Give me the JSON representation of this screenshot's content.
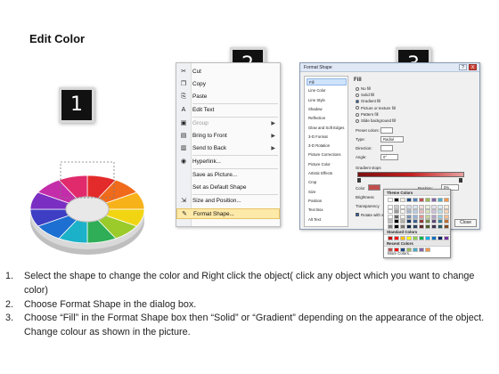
{
  "title": "Edit Color",
  "badges": [
    "1",
    "2",
    "3"
  ],
  "context_menu": {
    "items": [
      {
        "label": "Cut",
        "icon": "scissors-icon",
        "glyph": "✂",
        "disabled": false,
        "submenu": false
      },
      {
        "label": "Copy",
        "icon": "copy-icon",
        "glyph": "❐",
        "disabled": false,
        "submenu": false
      },
      {
        "label": "Paste",
        "icon": "paste-icon",
        "glyph": "⎘",
        "disabled": false,
        "submenu": false
      },
      {
        "label": "Edit Text",
        "icon": "edit-text-icon",
        "glyph": "A",
        "disabled": false,
        "submenu": false
      },
      {
        "label": "Group",
        "icon": "group-icon",
        "glyph": "▣",
        "disabled": true,
        "submenu": true
      },
      {
        "label": "Bring to Front",
        "icon": "bring-front-icon",
        "glyph": "▤",
        "disabled": false,
        "submenu": true
      },
      {
        "label": "Send to Back",
        "icon": "send-back-icon",
        "glyph": "▥",
        "disabled": false,
        "submenu": true
      },
      {
        "label": "Hyperlink...",
        "icon": "hyperlink-icon",
        "glyph": "◉",
        "disabled": false,
        "submenu": false
      },
      {
        "label": "Save as Picture...",
        "icon": "save-picture-icon",
        "glyph": "",
        "disabled": false,
        "submenu": false
      },
      {
        "label": "Set as Default Shape",
        "icon": "default-shape-icon",
        "glyph": "",
        "disabled": false,
        "submenu": false
      },
      {
        "label": "Size and Position...",
        "icon": "size-position-icon",
        "glyph": "⇲",
        "disabled": false,
        "submenu": false
      },
      {
        "label": "Format Shape...",
        "icon": "format-shape-icon",
        "glyph": "✎",
        "disabled": false,
        "submenu": false
      }
    ]
  },
  "dialog": {
    "title": "Format Shape",
    "help": "?",
    "close": "X",
    "nav": [
      "Fill",
      "Line Color",
      "Line Style",
      "Shadow",
      "Reflection",
      "Glow and Soft Edges",
      "3-D Format",
      "3-D Rotation",
      "Picture Corrections",
      "Picture Color",
      "Artistic Effects",
      "Crop",
      "Size",
      "Position",
      "Text Box",
      "Alt Text"
    ],
    "selected_nav": 0,
    "panel_heading": "Fill",
    "fill_options": [
      "No fill",
      "Solid fill",
      "Gradient fill",
      "Picture or texture fill",
      "Pattern fill",
      "Slide background fill"
    ],
    "selected_fill": 2,
    "fields": [
      {
        "label": "Preset colors:",
        "value": ""
      },
      {
        "label": "Type:",
        "value": "Radial"
      },
      {
        "label": "Direction:",
        "value": ""
      },
      {
        "label": "Angle:",
        "value": "0°"
      }
    ],
    "gradient_stops_label": "Gradient stops",
    "color_label": "Color",
    "position_label": "Position:",
    "position_value": "0%",
    "brightness_label": "Brightness",
    "transparency_label": "Transparency",
    "rotate_label": "Rotate with shape",
    "close_button": "Close"
  },
  "color_popup": {
    "theme_colors_label": "Theme Colors",
    "standard_colors_label": "Standard Colors",
    "recent_colors_label": "Recent Colors",
    "more_colors_label": "More Colors...",
    "theme_colors": [
      "#ffffff",
      "#000000",
      "#eeece1",
      "#1f497d",
      "#4f81bd",
      "#c0504d",
      "#9bbb59",
      "#8064a2",
      "#4bacc6",
      "#f79646"
    ],
    "standard_colors": [
      "#c00000",
      "#ff0000",
      "#ffc000",
      "#ffff00",
      "#92d050",
      "#00b050",
      "#00b0f0",
      "#0070c0",
      "#002060",
      "#7030a0"
    ],
    "recent_colors": [
      "#c0504d",
      "#ff0000",
      "#1f497d",
      "#9bbb59",
      "#4bacc6",
      "#8064a2",
      "#f79646"
    ]
  },
  "instructions": [
    {
      "num": "1.",
      "text": "Select the shape to change the color and Right click the object( click any object which you want to change color)"
    },
    {
      "num": "2.",
      "text": "Choose Format Shape in the dialog box."
    },
    {
      "num": "3.",
      "text": "Choose “Fill” in the Format Shape box then “Solid” or “Gradient” depending on the appearance of the object. Change colour as shown in the picture."
    }
  ],
  "colors": {
    "ring": [
      "#e32b2b",
      "#f06a1b",
      "#f7b21a",
      "#f1d513",
      "#9bcb2b",
      "#2fae57",
      "#1bb1c9",
      "#1d6fd1",
      "#3d3ec4",
      "#7b2fc2",
      "#c42daa",
      "#e12a6c"
    ],
    "highlight": "#fde9a8",
    "badge": "#111111"
  }
}
